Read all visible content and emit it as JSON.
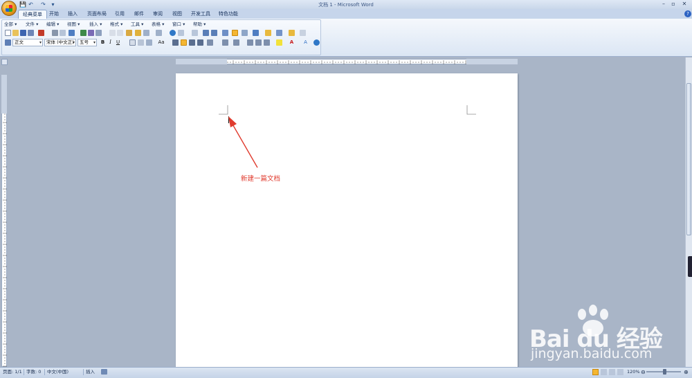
{
  "window": {
    "title": "文档 1 - Microsoft Word",
    "controls": {
      "minimize": "–",
      "restore": "▫",
      "close": "✕"
    }
  },
  "quick_access": [
    "save-icon",
    "undo-icon",
    "redo-icon",
    "customize-icon"
  ],
  "tabs": [
    {
      "label": "经典菜单",
      "active": true
    },
    {
      "label": "开始"
    },
    {
      "label": "插入"
    },
    {
      "label": "页面布局"
    },
    {
      "label": "引用"
    },
    {
      "label": "邮件"
    },
    {
      "label": "审阅"
    },
    {
      "label": "视图"
    },
    {
      "label": "开发工具"
    },
    {
      "label": "特色功能"
    }
  ],
  "menus": [
    "全部 ▾",
    "文件 ▾",
    "编辑 ▾",
    "视图 ▾",
    "插入 ▾",
    "格式 ▾",
    "工具 ▾",
    "表格 ▾",
    "窗口 ▾",
    "帮助 ▾"
  ],
  "format_bar": {
    "style": "正文",
    "font": "宋体 (中文正)",
    "size": "五号",
    "bold": "B",
    "italic": "I",
    "underline": "U",
    "font_color_letter": "A",
    "case_label": "Aa"
  },
  "document": {
    "annotation_text": "新建一篇文档"
  },
  "status": {
    "page": "页面: 1/1",
    "words": "字数: 0",
    "language": "中文(中国)",
    "mode": "插入",
    "zoom": "120%"
  },
  "watermark": {
    "logo": "Bai du 经验",
    "url": "jingyan.baidu.com"
  },
  "colors": {
    "accent": "#e03b2e",
    "ribbon": "#dbe6f4",
    "workspace": "#a9b5c7"
  }
}
